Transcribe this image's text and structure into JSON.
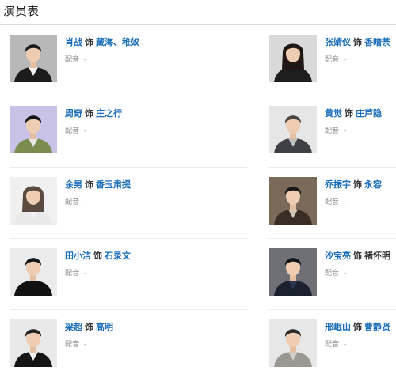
{
  "section": {
    "title": "演员表"
  },
  "cast": [
    {
      "actor": "肖战",
      "as": "饰",
      "role": "藏海、稚奴",
      "dub_label": "配音",
      "dub_value": "-",
      "photo_icon": "actor-photo",
      "bg": "#b8b8b8",
      "shirt": "#1c1c1c",
      "hair": "#1a1a1a",
      "collar": "#f3f3f3",
      "role_linked": true
    },
    {
      "actor": "张婧仪",
      "as": "饰",
      "role": "香暗荼",
      "dub_label": "配音",
      "dub_value": "-",
      "photo_icon": "actress-photo",
      "bg": "#d9d9d9",
      "shirt": "#1e1e1e",
      "hair": "#201714",
      "collar": "#1e1e1e",
      "role_linked": true
    },
    {
      "actor": "周奇",
      "as": "饰",
      "role": "庄之行",
      "dub_label": "配音",
      "dub_value": "-",
      "photo_icon": "actor-photo",
      "bg": "#c7c2e6",
      "shirt": "#7a8c4e",
      "hair": "#151515",
      "collar": "#e8e8e8",
      "role_linked": true
    },
    {
      "actor": "黄觉",
      "as": "饰",
      "role": "庄芦隐",
      "dub_label": "配音",
      "dub_value": "-",
      "photo_icon": "actor-photo",
      "bg": "#e6e6e6",
      "shirt": "#3f4046",
      "hair": "#4a4440",
      "collar": "#bfbfbf",
      "role_linked": true
    },
    {
      "actor": "余男",
      "as": "饰",
      "role": "香玉肃提",
      "dub_label": "配音",
      "dub_value": "-",
      "photo_icon": "actress-photo",
      "bg": "#f0f0f0",
      "shirt": "#e9e9e9",
      "hair": "#5a4a3f",
      "collar": "#f5f5f5",
      "role_linked": true
    },
    {
      "actor": "乔振宇",
      "as": "饰",
      "role": "永容",
      "dub_label": "配音",
      "dub_value": "-",
      "photo_icon": "actor-photo",
      "bg": "#7b6a5a",
      "shirt": "#3a2d24",
      "hair": "#161616",
      "collar": "#cfc6b5",
      "role_linked": true
    },
    {
      "actor": "田小洁",
      "as": "饰",
      "role": "石录文",
      "dub_label": "配音",
      "dub_value": "-",
      "photo_icon": "actor-photo",
      "bg": "#ebebeb",
      "shirt": "#111111",
      "hair": "#141414",
      "collar": "#111111",
      "role_linked": true
    },
    {
      "actor": "沙宝亮",
      "as": "饰",
      "role": "褚怀明",
      "dub_label": "配音",
      "dub_value": "-",
      "photo_icon": "actor-photo",
      "bg": "#6f7076",
      "shirt": "#1c2130",
      "hair": "#141414",
      "collar": "#2b3550",
      "role_linked": false
    },
    {
      "actor": "梁超",
      "as": "饰",
      "role": "高明",
      "dub_label": "配音",
      "dub_value": "-",
      "photo_icon": "actor-photo",
      "bg": "#e9e9e9",
      "shirt": "#151515",
      "hair": "#222222",
      "collar": "#f2f2f2",
      "role_linked": true
    },
    {
      "actor": "邢岷山",
      "as": "饰",
      "role": "曹静贤",
      "dub_label": "配音",
      "dub_value": "-",
      "photo_icon": "actor-photo",
      "bg": "#e7e7e7",
      "shirt": "#9a9890",
      "hair": "#2a2a2a",
      "collar": "#d0cec6",
      "role_linked": true
    }
  ]
}
